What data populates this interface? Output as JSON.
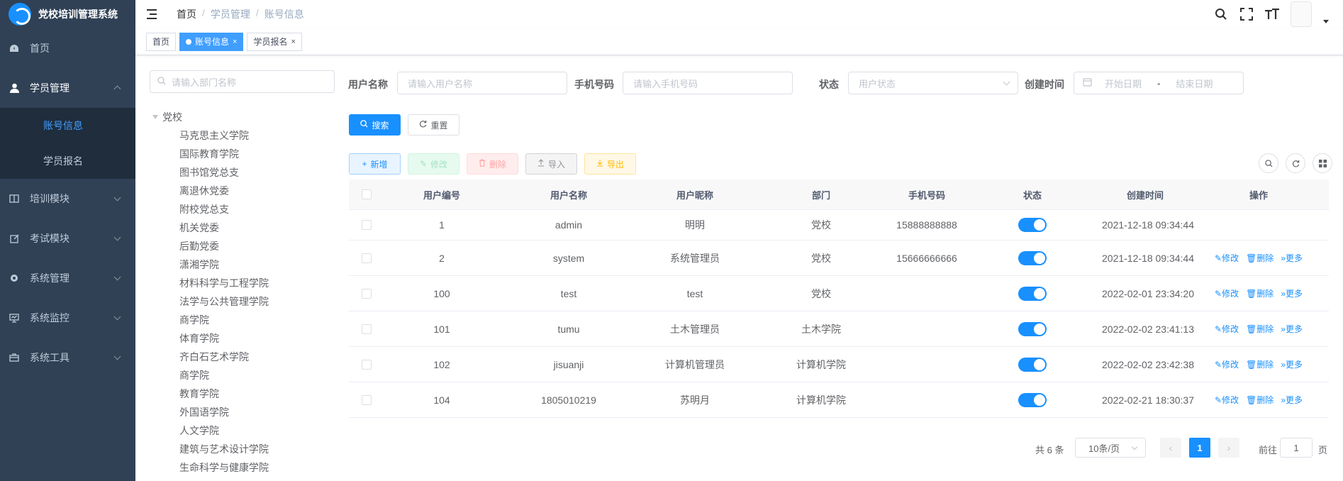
{
  "app": {
    "title": "党校培训管理系统"
  },
  "sidebar": {
    "items": [
      {
        "label": "首页",
        "icon": "dashboard-icon"
      },
      {
        "label": "学员管理",
        "icon": "user-icon",
        "expanded": true,
        "children": [
          {
            "label": "账号信息",
            "active": true
          },
          {
            "label": "学员报名"
          }
        ]
      },
      {
        "label": "培训模块",
        "icon": "book-icon"
      },
      {
        "label": "考试模块",
        "icon": "edit-icon"
      },
      {
        "label": "系统管理",
        "icon": "gear-icon"
      },
      {
        "label": "系统监控",
        "icon": "monitor-icon"
      },
      {
        "label": "系统工具",
        "icon": "toolbox-icon"
      }
    ]
  },
  "header": {
    "breadcrumb": [
      "首页",
      "学员管理",
      "账号信息"
    ],
    "separator": "/"
  },
  "tabs": [
    {
      "label": "首页",
      "active": false,
      "closable": false
    },
    {
      "label": "账号信息",
      "active": true,
      "closable": true
    },
    {
      "label": "学员报名",
      "active": false,
      "closable": true
    }
  ],
  "tab_close": "×",
  "dept": {
    "search_placeholder": "请输入部门名称",
    "root": "党校",
    "children": [
      "马克思主义学院",
      "国际教育学院",
      "图书馆党总支",
      "离退休党委",
      "附校党总支",
      "机关党委",
      "后勤党委",
      "潇湘学院",
      "材料科学与工程学院",
      "法学与公共管理学院",
      "商学院",
      "体育学院",
      "齐白石艺术学院",
      "商学院",
      "教育学院",
      "外国语学院",
      "人文学院",
      "建筑与艺术设计学院",
      "生命科学与健康学院"
    ]
  },
  "search_form": {
    "username_label": "用户名称",
    "username_placeholder": "请输入用户名称",
    "phone_label": "手机号码",
    "phone_placeholder": "请输入手机号码",
    "status_label": "状态",
    "status_placeholder": "用户状态",
    "created_label": "创建时间",
    "start_placeholder": "开始日期",
    "range_separator": "-",
    "end_placeholder": "结束日期",
    "search_button": "搜索",
    "reset_button": "重置"
  },
  "toolbar": {
    "add": "新增",
    "edit": "修改",
    "delete": "删除",
    "import": "导入",
    "export": "导出"
  },
  "table": {
    "columns": [
      "用户编号",
      "用户名称",
      "用户昵称",
      "部门",
      "手机号码",
      "状态",
      "创建时间",
      "操作"
    ],
    "rows": [
      {
        "id": "1",
        "name": "admin",
        "nick": "明明",
        "dept": "党校",
        "phone": "15888888888",
        "enabled": true,
        "created": "2021-12-18 09:34:44",
        "ops": false
      },
      {
        "id": "2",
        "name": "system",
        "nick": "系统管理员",
        "dept": "党校",
        "phone": "15666666666",
        "enabled": true,
        "created": "2021-12-18 09:34:44",
        "ops": true
      },
      {
        "id": "100",
        "name": "test",
        "nick": "test",
        "dept": "党校",
        "phone": "",
        "enabled": true,
        "created": "2022-02-01 23:34:20",
        "ops": true
      },
      {
        "id": "101",
        "name": "tumu",
        "nick": "土木管理员",
        "dept": "土木学院",
        "phone": "",
        "enabled": true,
        "created": "2022-02-02 23:41:13",
        "ops": true
      },
      {
        "id": "102",
        "name": "jisuanji",
        "nick": "计算机管理员",
        "dept": "计算机学院",
        "phone": "",
        "enabled": true,
        "created": "2022-02-02 23:42:38",
        "ops": true
      },
      {
        "id": "104",
        "name": "1805010219",
        "nick": "苏明月",
        "dept": "计算机学院",
        "phone": "",
        "enabled": true,
        "created": "2022-02-21 18:30:37",
        "ops": true
      }
    ],
    "row_ops": {
      "edit": "修改",
      "delete": "删除",
      "more": "更多"
    }
  },
  "pagination": {
    "total_text": "共 6 条",
    "page_size": "10条/页",
    "current_page": "1",
    "goto_label": "前往",
    "goto_value": "1",
    "goto_unit": "页"
  },
  "colors": {
    "sidebar_bg": "#304156",
    "submenu_bg": "#1f2d3d",
    "primary": "#1890ff"
  }
}
